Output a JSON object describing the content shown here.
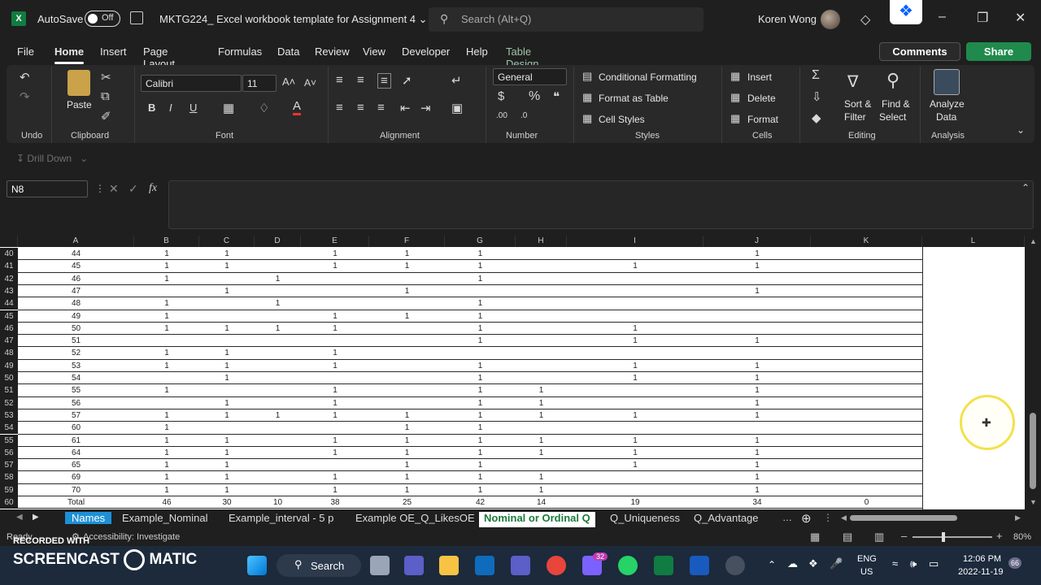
{
  "titlebar": {
    "autosave": "AutoSave",
    "toggle": "Off",
    "doc_title": "MKTG224_ Excel workbook template for Assignment 4",
    "search": "Search (Alt+Q)",
    "user": "Koren Wong"
  },
  "menu": {
    "tabs": [
      "File",
      "Home",
      "Insert",
      "Page Layout",
      "Formulas",
      "Data",
      "Review",
      "View",
      "Developer",
      "Help",
      "Table Design"
    ],
    "comments": "Comments",
    "share": "Share"
  },
  "ribbon": {
    "undo_label": "Undo",
    "clipboard_label": "Clipboard",
    "paste": "Paste",
    "font": "Calibri",
    "font_size": "11",
    "font_label": "Font",
    "alignment_label": "Alignment",
    "number_format": "General",
    "number_label": "Number",
    "cond_format": "Conditional Formatting",
    "format_table": "Format as Table",
    "cell_styles": "Cell Styles",
    "styles_label": "Styles",
    "insert": "Insert",
    "delete": "Delete",
    "format": "Format",
    "cells_label": "Cells",
    "sort_filter": "Sort &",
    "sort_filter2": "Filter",
    "find_select": "Find &",
    "find_select2": "Select",
    "editing_label": "Editing",
    "analyze": "Analyze",
    "analyze2": "Data",
    "analysis_label": "Analysis"
  },
  "drill": "Drill Down",
  "namebox": "N8",
  "columns": [
    "A",
    "B",
    "C",
    "D",
    "E",
    "F",
    "G",
    "H",
    "I",
    "J",
    "K",
    "L"
  ],
  "rows": [
    {
      "r": "40",
      "a": "44",
      "b": "1",
      "c": "1",
      "d": "",
      "e": "1",
      "f": "1",
      "g": "1",
      "h": "",
      "i": "",
      "j": "1",
      "k": ""
    },
    {
      "r": "41",
      "a": "45",
      "b": "1",
      "c": "1",
      "d": "",
      "e": "1",
      "f": "1",
      "g": "1",
      "h": "",
      "i": "1",
      "j": "1",
      "k": ""
    },
    {
      "r": "42",
      "a": "46",
      "b": "1",
      "c": "",
      "d": "1",
      "e": "",
      "f": "",
      "g": "1",
      "h": "",
      "i": "",
      "j": "",
      "k": ""
    },
    {
      "r": "43",
      "a": "47",
      "b": "",
      "c": "1",
      "d": "",
      "e": "",
      "f": "1",
      "g": "",
      "h": "",
      "i": "",
      "j": "1",
      "k": ""
    },
    {
      "r": "44",
      "a": "48",
      "b": "1",
      "c": "",
      "d": "1",
      "e": "",
      "f": "",
      "g": "1",
      "h": "",
      "i": "",
      "j": "",
      "k": ""
    },
    {
      "r": "45",
      "a": "49",
      "b": "1",
      "c": "",
      "d": "",
      "e": "1",
      "f": "1",
      "g": "1",
      "h": "",
      "i": "",
      "j": "",
      "k": ""
    },
    {
      "r": "46",
      "a": "50",
      "b": "1",
      "c": "1",
      "d": "1",
      "e": "1",
      "f": "",
      "g": "1",
      "h": "",
      "i": "1",
      "j": "",
      "k": ""
    },
    {
      "r": "47",
      "a": "51",
      "b": "",
      "c": "",
      "d": "",
      "e": "",
      "f": "",
      "g": "1",
      "h": "",
      "i": "1",
      "j": "1",
      "k": ""
    },
    {
      "r": "48",
      "a": "52",
      "b": "1",
      "c": "1",
      "d": "",
      "e": "1",
      "f": "",
      "g": "",
      "h": "",
      "i": "",
      "j": "",
      "k": ""
    },
    {
      "r": "49",
      "a": "53",
      "b": "1",
      "c": "1",
      "d": "",
      "e": "1",
      "f": "",
      "g": "1",
      "h": "",
      "i": "1",
      "j": "1",
      "k": ""
    },
    {
      "r": "50",
      "a": "54",
      "b": "",
      "c": "1",
      "d": "",
      "e": "",
      "f": "",
      "g": "1",
      "h": "",
      "i": "1",
      "j": "1",
      "k": ""
    },
    {
      "r": "51",
      "a": "55",
      "b": "1",
      "c": "",
      "d": "",
      "e": "1",
      "f": "",
      "g": "1",
      "h": "1",
      "i": "",
      "j": "1",
      "k": ""
    },
    {
      "r": "52",
      "a": "56",
      "b": "",
      "c": "1",
      "d": "",
      "e": "1",
      "f": "",
      "g": "1",
      "h": "1",
      "i": "",
      "j": "1",
      "k": ""
    },
    {
      "r": "53",
      "a": "57",
      "b": "1",
      "c": "1",
      "d": "1",
      "e": "1",
      "f": "1",
      "g": "1",
      "h": "1",
      "i": "1",
      "j": "1",
      "k": ""
    },
    {
      "r": "54",
      "a": "60",
      "b": "1",
      "c": "",
      "d": "",
      "e": "",
      "f": "1",
      "g": "1",
      "h": "",
      "i": "",
      "j": "",
      "k": ""
    },
    {
      "r": "55",
      "a": "61",
      "b": "1",
      "c": "1",
      "d": "",
      "e": "1",
      "f": "1",
      "g": "1",
      "h": "1",
      "i": "1",
      "j": "1",
      "k": ""
    },
    {
      "r": "56",
      "a": "64",
      "b": "1",
      "c": "1",
      "d": "",
      "e": "1",
      "f": "1",
      "g": "1",
      "h": "1",
      "i": "1",
      "j": "1",
      "k": ""
    },
    {
      "r": "57",
      "a": "65",
      "b": "1",
      "c": "1",
      "d": "",
      "e": "",
      "f": "1",
      "g": "1",
      "h": "",
      "i": "1",
      "j": "1",
      "k": ""
    },
    {
      "r": "58",
      "a": "69",
      "b": "1",
      "c": "1",
      "d": "",
      "e": "1",
      "f": "1",
      "g": "1",
      "h": "1",
      "i": "",
      "j": "1",
      "k": ""
    },
    {
      "r": "59",
      "a": "70",
      "b": "1",
      "c": "1",
      "d": "",
      "e": "1",
      "f": "1",
      "g": "1",
      "h": "1",
      "i": "",
      "j": "1",
      "k": ""
    },
    {
      "r": "60",
      "a": "Total",
      "b": "46",
      "c": "30",
      "d": "10",
      "e": "38",
      "f": "25",
      "g": "42",
      "h": "14",
      "i": "19",
      "j": "34",
      "k": "0"
    }
  ],
  "sheets": [
    "Names",
    "Example_Nominal",
    "Example_interval - 5 p",
    "Example OE_Q_LikesOE",
    "Nominal or Ordinal Q",
    "Q_Uniqueness",
    "Q_Advantage"
  ],
  "status": {
    "ready": "Ready",
    "accessibility": "Accessibility: Investigate",
    "zoom": "80%"
  },
  "watermark": {
    "line1": "RECORDED WITH",
    "line2": "SCREENCAST",
    "line3": "MATIC"
  },
  "taskbar": {
    "search": "Search",
    "lang1": "ENG",
    "lang2": "US",
    "time": "12:06 PM",
    "date": "2022-11-19",
    "badge_teams": "32",
    "badge_notif": "66"
  }
}
